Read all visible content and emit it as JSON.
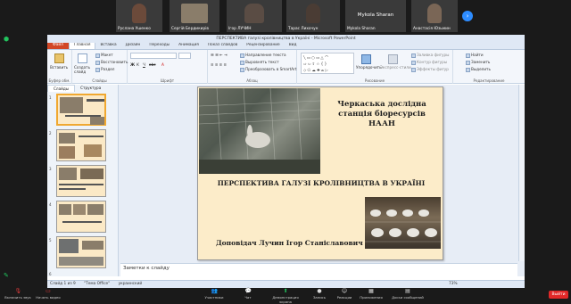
{
  "participants": [
    {
      "name": "Руслана Ушенко"
    },
    {
      "name": "Сергій Бердикирів"
    },
    {
      "name": "Ігор ЛУЧИН"
    },
    {
      "name": "Тарас Лихочун"
    },
    {
      "name": "Mykola Sharan"
    },
    {
      "name": "Mykola Sharan"
    },
    {
      "name": "Анастасія Юзьмин"
    }
  ],
  "ppt": {
    "window_title": "ПЕРСПЕКТИВА галузі кролівництва в Україні - Microsoft PowerPoint",
    "tabs": [
      "Файл",
      "Главная",
      "Вставка",
      "Дизайн",
      "Переходы",
      "Анимация",
      "Показ слайдов",
      "Рецензирование",
      "Вид"
    ],
    "ribbon": {
      "paste": "Вставить",
      "create_slide": "Создать слайд",
      "layout": "Макет",
      "restore": "Восстановить",
      "section": "Раздел",
      "text_direction": "Направление текста",
      "align_text": "Выровнять текст",
      "smartart": "Преобразовать в SmartArt",
      "arrange": "Упорядочить",
      "quick_styles": "Экспресс-стили",
      "shape_fill": "Заливка фигуры",
      "shape_outline": "Контур фигуры",
      "shape_effects": "Эффекты фигур",
      "find": "Найти",
      "replace": "Заменить",
      "select": "Выделить",
      "groups": [
        "Буфер обм.",
        "Слайды",
        "Шрифт",
        "Абзац",
        "Рисование",
        "Редактирование"
      ]
    },
    "side_tabs": [
      "Слайды",
      "Структура"
    ],
    "slide_numbers": [
      "1",
      "2",
      "3",
      "4",
      "5",
      "6"
    ],
    "slide": {
      "title": "Черкаська дослідна станція біоресурсів НААН",
      "subtitle": "ПЕРСПЕКТИВА ГАЛУЗІ КРОЛІВНИЦТВА В УКРАЇНІ",
      "author": "Доповідач Лучин Ігор Станіславович"
    },
    "notes_placeholder": "Заметки к слайду",
    "status": {
      "slide_counter": "Слайд 1 из 9",
      "theme": "\"Тема Office\"",
      "language": "украинский",
      "zoom": "73%"
    }
  },
  "zoom_controls": [
    {
      "label": "Включить звук",
      "icon": "mic-muted-icon"
    },
    {
      "label": "Начать видео",
      "icon": "video-off-icon"
    },
    {
      "label": "Участники",
      "icon": "participants-icon"
    },
    {
      "label": "Чат",
      "icon": "chat-icon"
    },
    {
      "label": "Демонстрация экрана",
      "icon": "share-screen-icon"
    },
    {
      "label": "Запись",
      "icon": "record-icon"
    },
    {
      "label": "Реакции",
      "icon": "reactions-icon"
    },
    {
      "label": "Приложения",
      "icon": "apps-icon"
    },
    {
      "label": "Доски сообщений",
      "icon": "whiteboard-icon"
    }
  ],
  "end_label": "Выйти",
  "colors": {
    "accent": "#2d8cff",
    "share_green": "#22c55e",
    "end_red": "#e02828",
    "slide_bg": "#fcecc9",
    "file_tab": "#d24726"
  }
}
